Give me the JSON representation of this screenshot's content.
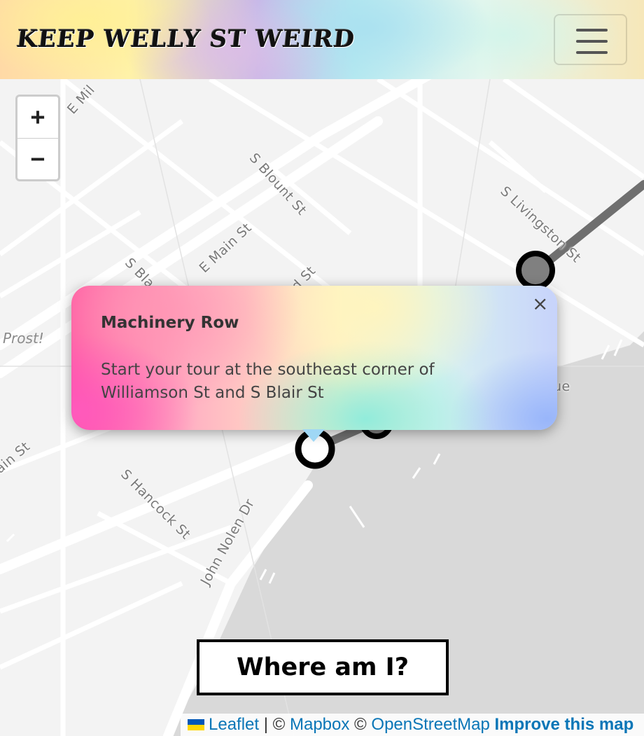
{
  "navbar": {
    "brand": "KEEP WELLY ST WEIRD",
    "toggler_icon": "hamburger-menu-icon"
  },
  "map": {
    "zoom_in_label": "+",
    "zoom_out_label": "−",
    "street_labels": {
      "e_mill": "E Mil",
      "s_blount": "S Blount St",
      "s_livingston": "S Livingston St",
      "e_main": "E Main St",
      "s_blair": "S Bla",
      "s_ward": "d St",
      "main_st": "ain St",
      "s_hancock": "S Hancock St",
      "john_nolen": "John Nolen Dr",
      "ue": "ue"
    },
    "poi_label": "Prost!",
    "colors": {
      "route": "#6f6f6f",
      "water": "#d9d9d9",
      "land": "#f3f3f3"
    }
  },
  "popup": {
    "title": "Machinery Row",
    "body": "Start your tour at the southeast corner of Williamson St and S Blair St",
    "close": "×"
  },
  "where_button": "Where am I?",
  "attribution": {
    "leaflet": "Leaflet",
    "sep1": " | © ",
    "mapbox": "Mapbox",
    "sep2": " © ",
    "osm": "OpenStreetMap",
    "improve": "Improve this map"
  }
}
